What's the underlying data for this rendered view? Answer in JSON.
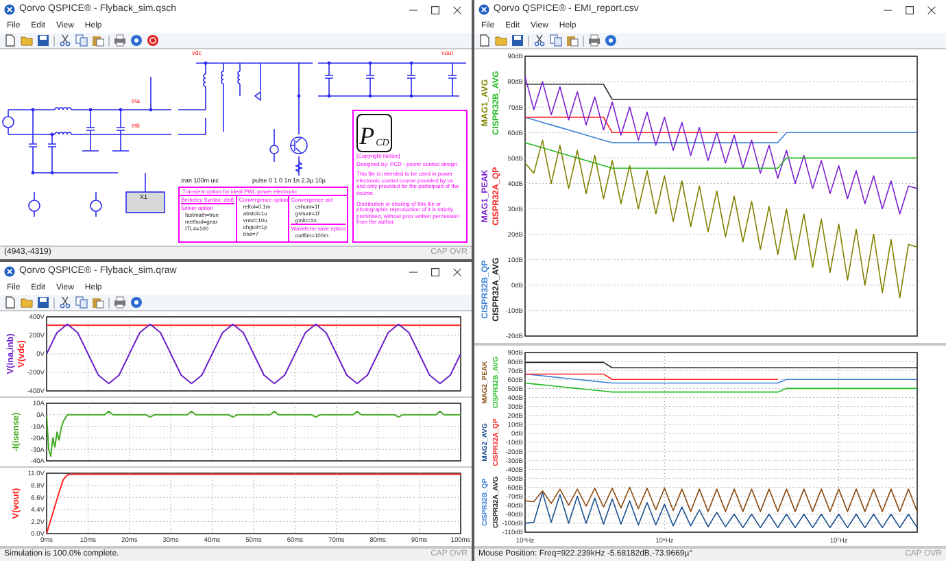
{
  "schematic_window": {
    "kind": "schematic",
    "title": "Qorvo QSPICE® - Flyback_sim.qsch",
    "menu": [
      "File",
      "Edit",
      "View",
      "Help"
    ],
    "schematic": {
      "net_labels": [
        "vdc",
        "vout",
        "ina",
        "inb"
      ],
      "instance": "X1",
      "directive": ".tran 100m uic",
      "pulse_spec": "pulse 0 1 0 1n 1n 2.3µ 10µ",
      "options_box": {
        "heading": "Transient option for ideal PWL power electronic",
        "syntax": "Berkeley Syntax: dis8",
        "columns": [
          {
            "title": "Solver option",
            "lines": [
              "fastmath=true",
              "method=gear",
              "ITL4=100"
            ]
          },
          {
            "title": "Convergence option",
            "lines": [
              "reltol=0.1m",
              "abstol=1u",
              "vntol=10u",
              "chgtol=1p",
              "trtol=7"
            ]
          },
          {
            "title": "Convergence aid",
            "lines": [
              "cshunt=1f",
              "gshunt=1f",
              "gmin=1n"
            ]
          },
          {
            "title": "Waveform save option",
            "lines": [
              "outflim=100m"
            ]
          }
        ]
      },
      "notice": {
        "logo_main": "P",
        "logo_sub": "CD",
        "heading": "[Copyright Notice]",
        "designer": "Designed by: PCD - power control design",
        "paragraphs": [
          "This file is intended to be used in power electronic control course provided by us and only provided for the participant of the course.",
          "Distribution or sharing of this file or photographic reproduction of it is strictly prohibited, without prior written permission from the author."
        ]
      }
    },
    "status": "(4943,-4319)",
    "indicators": "CAP OVR"
  },
  "waveform_window": {
    "kind": "waveform",
    "title": "Qorvo QSPICE® - Flyback_sim.qraw",
    "menu": [
      "File",
      "Edit",
      "View",
      "Help"
    ],
    "panes": [
      {
        "chart_data": {
          "type": "line",
          "grid": true,
          "xlim": [
            0,
            100
          ],
          "ylim": [
            -400,
            400
          ],
          "yticks": [
            {
              "value": 400,
              "label": "400V"
            },
            {
              "value": 200,
              "label": "200V"
            },
            {
              "value": 0,
              "label": "0V"
            },
            {
              "value": -200,
              "label": "-200V"
            },
            {
              "value": -400,
              "label": "-400V"
            }
          ],
          "x": [
            0,
            2.5,
            5,
            7.5,
            10,
            12.5,
            15,
            17.5,
            20,
            22.5,
            25,
            27.5,
            30,
            32.5,
            35,
            37.5,
            40,
            42.5,
            45,
            47.5,
            50,
            52.5,
            55,
            57.5,
            60,
            62.5,
            65,
            67.5,
            70,
            72.5,
            75,
            77.5,
            80,
            82.5,
            85,
            87.5,
            90,
            92.5,
            95,
            97.5,
            100
          ],
          "series": [
            {
              "name": "V(ina,inb)",
              "color": "#6a1fc8",
              "values": [
                0,
                230,
                320,
                230,
                0,
                -230,
                -320,
                -230,
                0,
                230,
                320,
                230,
                0,
                -230,
                -320,
                -230,
                0,
                230,
                320,
                230,
                0,
                -230,
                -320,
                -230,
                0,
                230,
                320,
                230,
                0,
                -230,
                -320,
                -230,
                0,
                230,
                320,
                230,
                0,
                -230,
                -320,
                -230,
                0
              ]
            },
            {
              "name": "V(vdc)",
              "color": "#ff2020",
              "values": [
                310,
                310,
                310,
                310,
                310,
                310,
                310,
                310,
                310,
                310,
                310,
                310,
                310,
                310,
                310,
                310,
                310,
                310,
                310,
                310,
                310,
                310,
                310,
                310,
                310,
                310,
                310,
                310,
                310,
                310,
                310,
                310,
                310,
                310,
                310,
                310,
                310,
                310,
                310,
                310,
                310
              ]
            }
          ]
        }
      },
      {
        "chart_data": {
          "type": "line",
          "grid": true,
          "xlim": [
            0,
            100
          ],
          "ylim": [
            -40,
            10
          ],
          "yticks": [
            {
              "value": 10,
              "label": "10A"
            },
            {
              "value": 0,
              "label": "0A"
            },
            {
              "value": -10,
              "label": "-10A"
            },
            {
              "value": -20,
              "label": "-20A"
            },
            {
              "value": -30,
              "label": "-30A"
            },
            {
              "value": -40,
              "label": "-40A"
            }
          ],
          "x": [
            0,
            0.5,
            1,
            1.5,
            2,
            2.5,
            3,
            3.5,
            4,
            5,
            14,
            15,
            16,
            24,
            25,
            26,
            34,
            35,
            36,
            44,
            45,
            46,
            54,
            55,
            56,
            64,
            65,
            66,
            74,
            75,
            76,
            84,
            85,
            86,
            94,
            95,
            96,
            100
          ],
          "series": [
            {
              "name": "-I(isense)",
              "color": "#44aa22",
              "values": [
                0,
                -30,
                -36,
                -20,
                -28,
                -15,
                -22,
                -12,
                -6,
                0,
                0,
                3,
                0,
                0,
                -2,
                0,
                0,
                3,
                0,
                0,
                -2,
                0,
                0,
                3,
                0,
                0,
                -2,
                0,
                0,
                3,
                0,
                0,
                -2,
                0,
                0,
                3,
                0,
                0
              ]
            }
          ]
        }
      },
      {
        "chart_data": {
          "type": "line",
          "grid": true,
          "xlim": [
            0,
            100
          ],
          "ylim": [
            0,
            11
          ],
          "xticks": [
            {
              "value": 0,
              "label": "0ms"
            },
            {
              "value": 10,
              "label": "10ms"
            },
            {
              "value": 20,
              "label": "20ms"
            },
            {
              "value": 30,
              "label": "30ms"
            },
            {
              "value": 40,
              "label": "40ms"
            },
            {
              "value": 50,
              "label": "50ms"
            },
            {
              "value": 60,
              "label": "60ms"
            },
            {
              "value": 70,
              "label": "70ms"
            },
            {
              "value": 80,
              "label": "80ms"
            },
            {
              "value": 90,
              "label": "90ms"
            },
            {
              "value": 100,
              "label": "100ms"
            }
          ],
          "yticks": [
            {
              "value": 11,
              "label": "11.0V"
            },
            {
              "value": 8.8,
              "label": "8.8V"
            },
            {
              "value": 6.6,
              "label": "6.6V"
            },
            {
              "value": 4.4,
              "label": "4.4V"
            },
            {
              "value": 2.2,
              "label": "2.2V"
            },
            {
              "value": 0,
              "label": "0.0V"
            }
          ],
          "x": [
            0,
            1,
            2,
            3,
            4,
            5,
            6,
            100
          ],
          "series": [
            {
              "name": "V(vout)",
              "color": "#ff2020",
              "values": [
                0,
                2.5,
                5,
                7.5,
                9.8,
                10.7,
                10.8,
                10.8
              ]
            }
          ]
        }
      }
    ],
    "status": "Simulation is 100.0% complete.",
    "indicators": "CAP OVR"
  },
  "emi_window": {
    "kind": "emi",
    "title": "Qorvo QSPICE® - EMI_report.csv",
    "menu": [
      "File",
      "Edit",
      "View",
      "Help"
    ],
    "panes": [
      {
        "chart_data": {
          "type": "line",
          "grid": true,
          "ylim": [
            -20,
            90
          ],
          "categories": [
            null,
            null,
            null,
            null,
            null,
            null,
            null,
            null,
            null,
            null,
            null,
            null,
            null,
            null,
            null,
            null,
            null,
            null,
            null,
            null,
            null,
            null,
            null,
            null,
            null,
            null,
            null,
            null,
            null,
            null,
            null,
            null,
            null,
            null,
            null,
            null,
            null,
            null,
            null,
            null,
            null,
            null,
            null,
            null,
            null,
            null
          ],
          "yticks": [
            {
              "value": 90,
              "label": "90dB"
            },
            {
              "value": 80,
              "label": "80dB"
            },
            {
              "value": 70,
              "label": "70dB"
            },
            {
              "value": 60,
              "label": "60dB"
            },
            {
              "value": 50,
              "label": "50dB"
            },
            {
              "value": 40,
              "label": "40dB"
            },
            {
              "value": 30,
              "label": "30dB"
            },
            {
              "value": 20,
              "label": "20dB"
            },
            {
              "value": 10,
              "label": "10dB"
            },
            {
              "value": 0,
              "label": "0dB"
            },
            {
              "value": -10,
              "label": "-10dB"
            },
            {
              "value": -20,
              "label": "-20dB"
            }
          ],
          "series": [
            {
              "name": "MAG1_AVG",
              "color": "#808000",
              "values": [
                48,
                44,
                57,
                40,
                55,
                38,
                53,
                36,
                51,
                34,
                49,
                32,
                47,
                30,
                45,
                28,
                43,
                25,
                41,
                23,
                39,
                21,
                37,
                19,
                35,
                17,
                33,
                14,
                31,
                12,
                30,
                10,
                28,
                7,
                26,
                5,
                24,
                2,
                22,
                0,
                20,
                -3,
                18,
                -5,
                16,
                15
              ]
            },
            {
              "name": "CISPR32B_AVG",
              "color": "#22bb22",
              "values": [
                56,
                55,
                54,
                53,
                52,
                51,
                50,
                49,
                48,
                47,
                46,
                46,
                46,
                46,
                46,
                46,
                46,
                46,
                46,
                46,
                46,
                46,
                46,
                46,
                46,
                46,
                46,
                46,
                46,
                46,
                50,
                50,
                50,
                50,
                50,
                50,
                50,
                50,
                50,
                50,
                50,
                50,
                50,
                50,
                50,
                50
              ]
            },
            {
              "name": "MAG1_PEAK",
              "color": "#7b1fd1",
              "values": [
                82,
                69,
                80,
                67,
                78,
                65,
                76,
                63,
                74,
                61,
                72,
                59,
                70,
                57,
                68,
                55,
                66,
                53,
                64,
                51,
                62,
                49,
                60,
                48,
                59,
                46,
                57,
                44,
                55,
                42,
                53,
                40,
                51,
                38,
                49,
                36,
                47,
                34,
                45,
                32,
                43,
                30,
                41,
                28,
                39,
                38
              ]
            },
            {
              "name": "CISPR32A_QP",
              "color": "#ff2020",
              "values": [
                66,
                66,
                66,
                66,
                66,
                66,
                66,
                66,
                66,
                66,
                60,
                60,
                60,
                60,
                60,
                60,
                60,
                60,
                60,
                60,
                60,
                60,
                60,
                60,
                60,
                60,
                60,
                60,
                60,
                60,
                null,
                null,
                null,
                null,
                null,
                null,
                null,
                null,
                null,
                null,
                null,
                null,
                null,
                null,
                null,
                null
              ]
            },
            {
              "name": "CISPR32B_QP",
              "color": "#3b82d6",
              "values": [
                66,
                65,
                64,
                63,
                62,
                61,
                60,
                59,
                58,
                57,
                56,
                56,
                56,
                56,
                56,
                56,
                56,
                56,
                56,
                56,
                56,
                56,
                56,
                56,
                56,
                56,
                56,
                56,
                56,
                56,
                60,
                60,
                60,
                60,
                60,
                60,
                60,
                60,
                60,
                60,
                60,
                60,
                60,
                60,
                60,
                60
              ]
            },
            {
              "name": "CISPR32A_AVG",
              "color": "#202020",
              "values": [
                79,
                79,
                79,
                79,
                79,
                79,
                79,
                79,
                79,
                79,
                73,
                73,
                73,
                73,
                73,
                73,
                73,
                73,
                73,
                73,
                73,
                73,
                73,
                73,
                73,
                73,
                73,
                73,
                73,
                73,
                73,
                73,
                73,
                73,
                73,
                73,
                73,
                73,
                73,
                73,
                73,
                73,
                73,
                73,
                73,
                73
              ]
            }
          ]
        }
      },
      {
        "chart_data": {
          "type": "line",
          "grid": true,
          "ylim": [
            -110,
            90
          ],
          "categories": [
            "10⁵Hz",
            null,
            null,
            null,
            null,
            null,
            null,
            null,
            null,
            null,
            null,
            null,
            null,
            null,
            null,
            null,
            "10⁶Hz",
            null,
            null,
            null,
            null,
            null,
            null,
            null,
            null,
            null,
            null,
            null,
            null,
            null,
            null,
            null,
            null,
            null,
            null,
            null,
            "10⁷Hz",
            null,
            null,
            null,
            null,
            null,
            null,
            null,
            null,
            null
          ],
          "yticks": [
            {
              "value": 90,
              "label": "90dB"
            },
            {
              "value": 80,
              "label": "80dB"
            },
            {
              "value": 70,
              "label": "70dB"
            },
            {
              "value": 60,
              "label": "60dB"
            },
            {
              "value": 50,
              "label": "50dB"
            },
            {
              "value": 40,
              "label": "40dB"
            },
            {
              "value": 30,
              "label": "30dB"
            },
            {
              "value": 20,
              "label": "20dB"
            },
            {
              "value": 10,
              "label": "10dB"
            },
            {
              "value": 0,
              "label": "0dB"
            },
            {
              "value": -10,
              "label": "-10dB"
            },
            {
              "value": -20,
              "label": "-20dB"
            },
            {
              "value": -30,
              "label": "-30dB"
            },
            {
              "value": -40,
              "label": "-40dB"
            },
            {
              "value": -50,
              "label": "-50dB"
            },
            {
              "value": -60,
              "label": "-60dB"
            },
            {
              "value": -70,
              "label": "-70dB"
            },
            {
              "value": -80,
              "label": "-80dB"
            },
            {
              "value": -90,
              "label": "-90dB"
            },
            {
              "value": -100,
              "label": "-100dB"
            },
            {
              "value": -110,
              "label": "-110dB"
            }
          ],
          "series": [
            {
              "name": "MAG2_PEAK",
              "color": "#8b4a10",
              "values": [
                -75,
                -76,
                -64,
                -78,
                -62,
                -80,
                -62,
                -81,
                -61,
                -82,
                -61,
                -83,
                -60,
                -84,
                -61,
                -85,
                -61,
                -86,
                -62,
                -87,
                -62,
                -87,
                -62,
                -87,
                -62,
                -87,
                -62,
                -87,
                -62,
                -87,
                -62,
                -87,
                -62,
                -87,
                -62,
                -87,
                -62,
                -87,
                -62,
                -87,
                -62,
                -87,
                -62,
                -87,
                -62,
                -87
              ]
            },
            {
              "name": "CISPR32B_AVG",
              "color": "#22bb22",
              "values": [
                56,
                55,
                54,
                53,
                52,
                51,
                50,
                49,
                48,
                47,
                46,
                46,
                46,
                46,
                46,
                46,
                46,
                46,
                46,
                46,
                46,
                46,
                46,
                46,
                46,
                46,
                46,
                46,
                46,
                46,
                50,
                50,
                50,
                50,
                50,
                50,
                50,
                50,
                50,
                50,
                50,
                50,
                50,
                50,
                50,
                50
              ]
            },
            {
              "name": "MAG2_AVG",
              "color": "#1a4f8f",
              "values": [
                -100,
                -99,
                -66,
                -99,
                -68,
                -100,
                -70,
                -100,
                -72,
                -101,
                -73,
                -101,
                -75,
                -102,
                -77,
                -102,
                -79,
                -103,
                -82,
                -103,
                -85,
                -104,
                -88,
                -104,
                -90,
                -105,
                -90,
                -105,
                -90,
                -105,
                -90,
                -105,
                -90,
                -105,
                -90,
                -105,
                -90,
                -105,
                -90,
                -105,
                -90,
                -105,
                -90,
                -105,
                -90,
                -105
              ]
            },
            {
              "name": "CISPR32A_QP",
              "color": "#ff2020",
              "values": [
                66,
                66,
                66,
                66,
                66,
                66,
                66,
                66,
                66,
                66,
                60,
                60,
                60,
                60,
                60,
                60,
                60,
                60,
                60,
                60,
                60,
                60,
                60,
                60,
                60,
                60,
                60,
                60,
                60,
                60,
                null,
                null,
                null,
                null,
                null,
                null,
                null,
                null,
                null,
                null,
                null,
                null,
                null,
                null,
                null,
                null
              ]
            },
            {
              "name": "CISPR32B_QP",
              "color": "#3b82d6",
              "values": [
                66,
                65,
                64,
                63,
                62,
                61,
                60,
                59,
                58,
                57,
                56,
                56,
                56,
                56,
                56,
                56,
                56,
                56,
                56,
                56,
                56,
                56,
                56,
                56,
                56,
                56,
                56,
                56,
                56,
                56,
                60,
                60,
                60,
                60,
                60,
                60,
                60,
                60,
                60,
                60,
                60,
                60,
                60,
                60,
                60,
                60
              ]
            },
            {
              "name": "CISPR32A_AVG",
              "color": "#202020",
              "values": [
                79,
                79,
                79,
                79,
                79,
                79,
                79,
                79,
                79,
                79,
                73,
                73,
                73,
                73,
                73,
                73,
                73,
                73,
                73,
                73,
                73,
                73,
                73,
                73,
                73,
                73,
                73,
                73,
                73,
                73,
                73,
                73,
                73,
                73,
                73,
                73,
                73,
                73,
                73,
                73,
                73,
                73,
                73,
                73,
                73,
                73
              ]
            }
          ]
        }
      }
    ],
    "status": "Mouse Position: Freq=922.239kHz   -5.68182dB,-73.9669µ°",
    "indicators": "CAP OVR"
  }
}
